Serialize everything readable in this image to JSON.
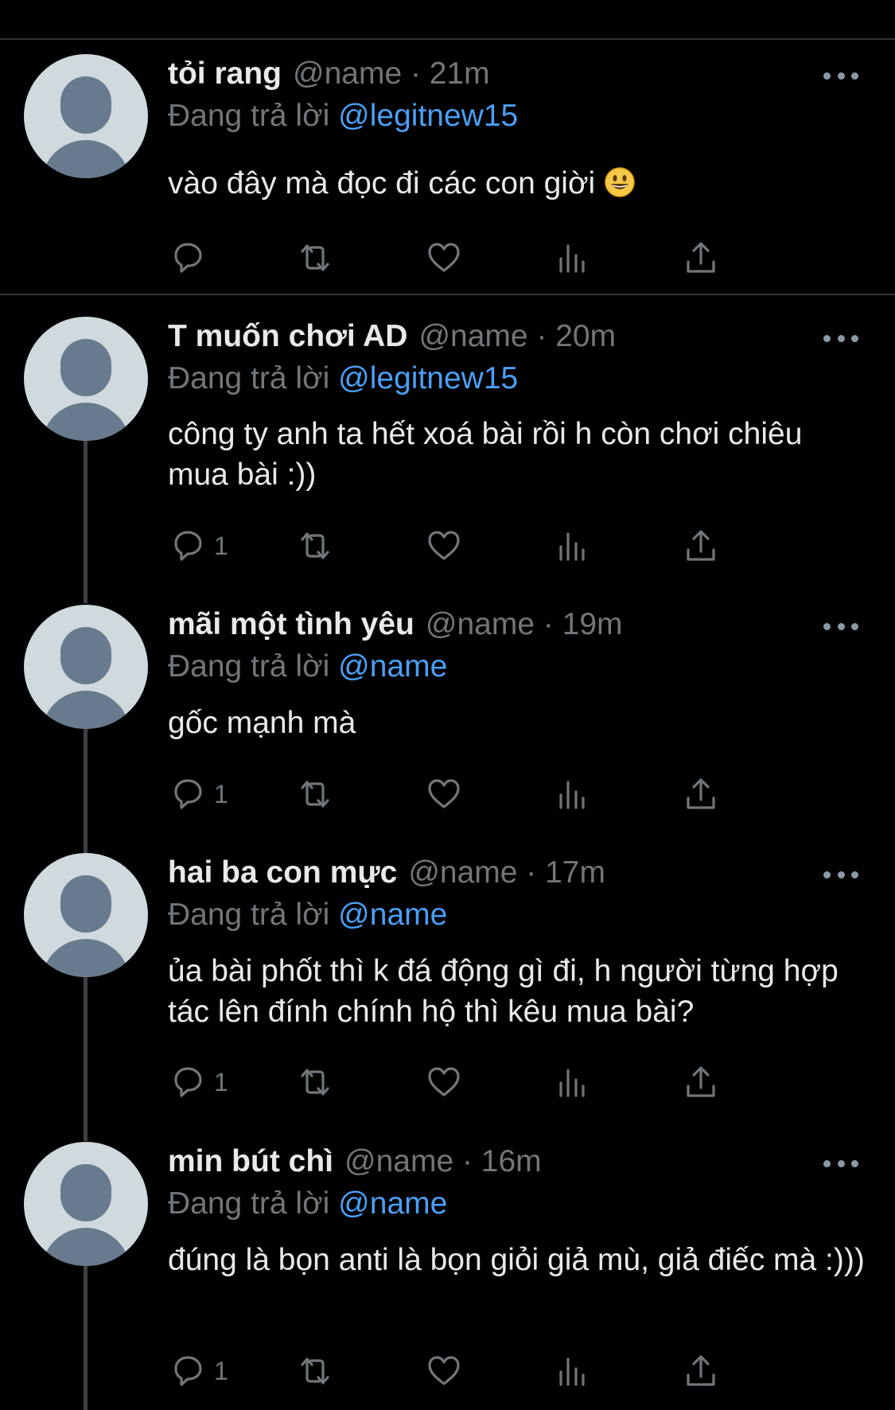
{
  "colors": {
    "background": "#000000",
    "text": "#e7e9ea",
    "muted": "#71767b",
    "mention": "#4a9ff5",
    "separator": "#2f3336"
  },
  "tweets": [
    {
      "name": "tỏi rang",
      "handle": "@name · 21m",
      "reply_prefix": "Đang trả lời",
      "reply_to": "@legitnew15",
      "text": "vào đây mà đọc đi các con giời",
      "emoji": "grinning-face-emoji",
      "reply_count": ""
    },
    {
      "name": "T muốn chơi AD",
      "handle": "@name · 20m",
      "reply_prefix": "Đang trả lời",
      "reply_to": "@legitnew15",
      "text": "công ty anh ta hết xoá bài rồi h còn chơi chiêu mua bài :))",
      "reply_count": "1"
    },
    {
      "name": "mãi một tình yêu",
      "handle": "@name · 19m",
      "reply_prefix": "Đang trả lời",
      "reply_to": "@name",
      "text": "gốc mạnh mà",
      "reply_count": "1"
    },
    {
      "name": "hai ba con mực",
      "handle": "@name · 17m",
      "reply_prefix": "Đang trả lời",
      "reply_to": "@name",
      "text": "ủa bài phốt thì k đá động gì đi, h người từng hợp tác lên đính chính hộ thì kêu mua bài?",
      "reply_count": "1"
    },
    {
      "name": "min bút chì",
      "handle": "@name · 16m",
      "reply_prefix": "Đang trả lời",
      "reply_to": "@name",
      "text": "đúng là bọn anti là bọn giỏi giả mù, giả điếc mà :)))",
      "reply_count": "1"
    }
  ],
  "icons": {
    "reply": "reply-icon",
    "retweet": "retweet-icon",
    "like": "heart-icon",
    "views": "analytics-icon",
    "share": "share-icon",
    "more": "more-icon"
  }
}
